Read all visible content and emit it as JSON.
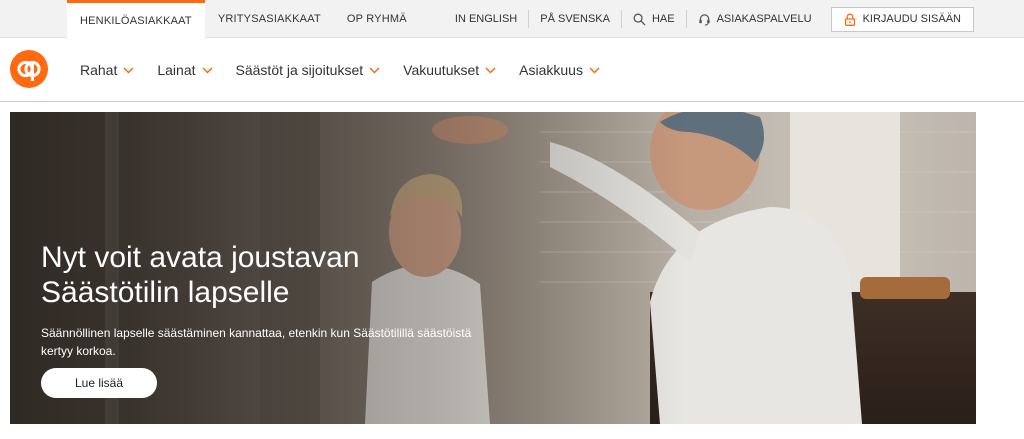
{
  "top_bar": {
    "segments": [
      {
        "label": "HENKILÖASIAKKAAT",
        "active": true
      },
      {
        "label": "YRITYSASIAKKAAT",
        "active": false
      },
      {
        "label": "OP RYHMÄ",
        "active": false
      }
    ],
    "utility": {
      "english": "IN ENGLISH",
      "swedish": "PÅ SVENSKA",
      "search": "HAE",
      "customer_service": "ASIAKASPALVELU",
      "login": "KIRJAUDU SISÄÄN"
    }
  },
  "main_nav": {
    "items": [
      {
        "label": "Rahat"
      },
      {
        "label": "Lainat"
      },
      {
        "label": "Säästöt ja sijoitukset"
      },
      {
        "label": "Vakuutukset"
      },
      {
        "label": "Asiakkuus"
      }
    ]
  },
  "hero": {
    "title": "Nyt voit avata joustavan Säästötilin lapselle",
    "subtitle": "Säännöllinen lapselle säästäminen kannattaa, etenkin kun Säästötilillä säästöistä kertyy korkoa.",
    "cta": "Lue lisää"
  },
  "colors": {
    "brand_orange": "#ff6a10",
    "topbar_bg": "#f2f2f2"
  },
  "icons": {
    "logo": "op-logo",
    "search": "search-icon",
    "customer_service": "headset-icon",
    "login": "lock-icon",
    "menu_chevron": "chevron-down-icon"
  }
}
